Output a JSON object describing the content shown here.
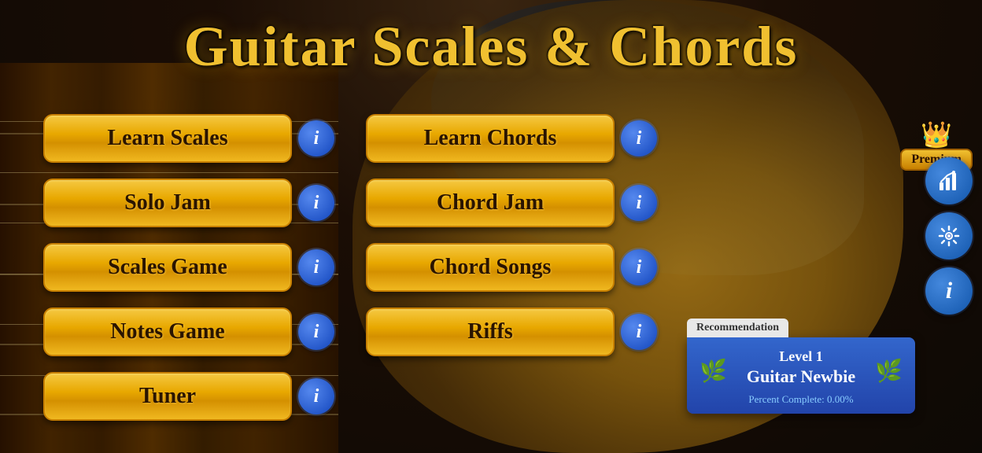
{
  "title": "Guitar Scales & Chords",
  "menu": {
    "left_column": [
      {
        "id": "learn-scales",
        "label": "Learn Scales"
      },
      {
        "id": "solo-jam",
        "label": "Solo Jam"
      },
      {
        "id": "scales-game",
        "label": "Scales Game"
      },
      {
        "id": "notes-game",
        "label": "Notes Game"
      },
      {
        "id": "tuner",
        "label": "Tuner"
      }
    ],
    "right_column": [
      {
        "id": "learn-chords",
        "label": "Learn Chords"
      },
      {
        "id": "chord-jam",
        "label": "Chord Jam"
      },
      {
        "id": "chord-songs",
        "label": "Chord Songs"
      },
      {
        "id": "riffs",
        "label": "Riffs"
      }
    ]
  },
  "premium": {
    "label": "Premium",
    "crown": "👑"
  },
  "recommendation": {
    "label": "Recommendation",
    "level": "Level 1",
    "title": "Guitar Newbie",
    "percent_label": "Percent Complete:",
    "percent_value": "0.00%"
  },
  "info_icon": "i",
  "icons": {
    "chart": "📊",
    "gear": "⚙",
    "info": "ℹ"
  }
}
